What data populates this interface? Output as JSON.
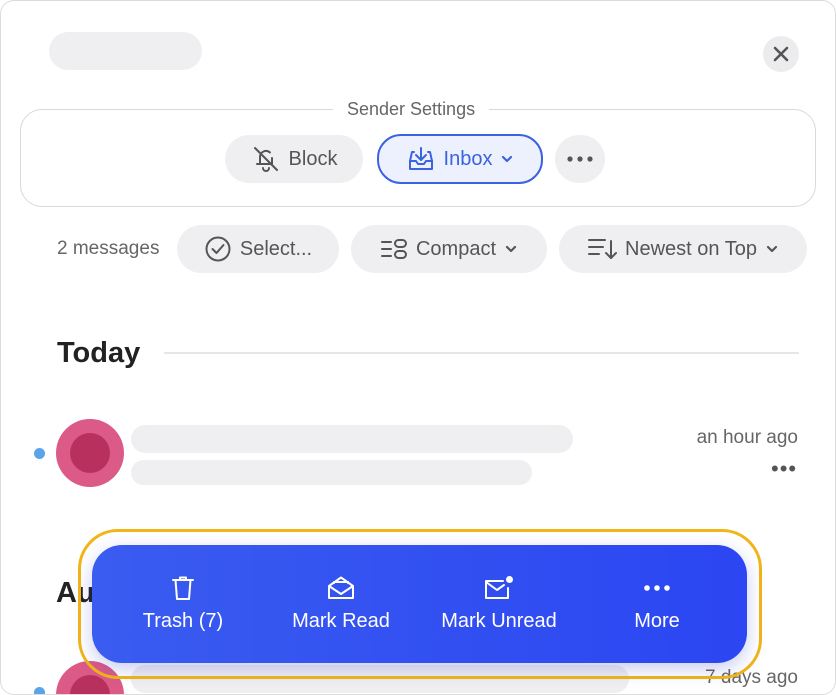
{
  "sender_settings": {
    "title": "Sender Settings",
    "block_label": "Block",
    "inbox_label": "Inbox"
  },
  "toolbar": {
    "message_count": "2 messages",
    "select_label": "Select...",
    "compact_label": "Compact",
    "sort_label": "Newest on Top"
  },
  "sections": [
    {
      "title": "Today",
      "items": [
        {
          "time": "an hour ago",
          "unread": true
        }
      ]
    },
    {
      "title": "Au",
      "items": [
        {
          "time": "7 days ago",
          "unread": true
        }
      ]
    }
  ],
  "action_bar": {
    "trash_label": "Trash (7)",
    "mark_read_label": "Mark Read",
    "mark_unread_label": "Mark Unread",
    "more_label": "More"
  },
  "colors": {
    "accent": "#3b62e0",
    "action_bar": "#2f4ff1",
    "highlight": "#f2b517",
    "avatar": "#db5a87",
    "unread_dot": "#5aa5ea"
  },
  "icons": {
    "close": "close-icon",
    "block": "bell-slash-icon",
    "inbox": "inbox-tray-icon",
    "select": "check-circle-icon",
    "compact": "list-compact-icon",
    "sort": "sort-descending-icon",
    "trash": "trash-icon",
    "mark_read": "envelope-open-icon",
    "mark_unread": "envelope-dot-icon",
    "more": "ellipsis-icon"
  }
}
